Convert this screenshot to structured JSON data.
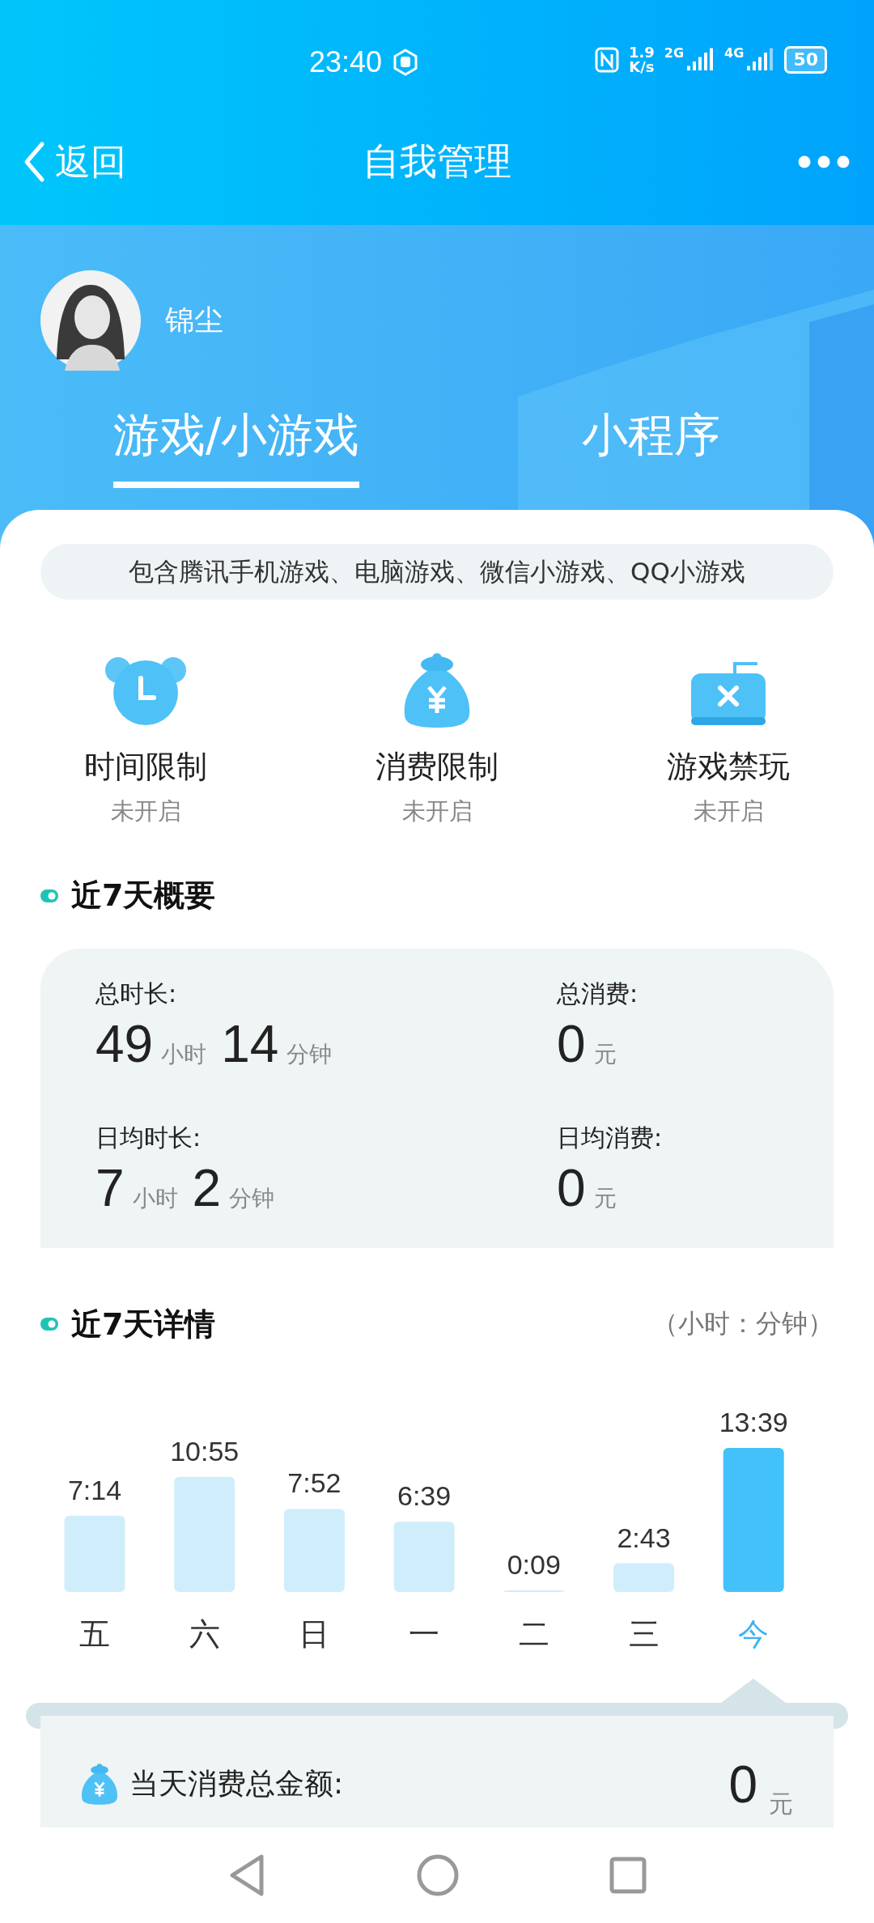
{
  "status_bar": {
    "time": "23:40",
    "speed_value": "1.9",
    "speed_unit": "K/s",
    "network_1": "2G",
    "network_2": "4G",
    "battery": "50"
  },
  "nav": {
    "back": "返回",
    "title": "自我管理"
  },
  "profile": {
    "name": "锦尘"
  },
  "tabs": [
    {
      "label": "游戏/小游戏",
      "selected": true
    },
    {
      "label": "小程序",
      "selected": false
    }
  ],
  "notice": "包含腾讯手机游戏、电脑游戏、微信小游戏、QQ小游戏",
  "controls": [
    {
      "kind": "clock",
      "label": "时间限制",
      "status": "未开启"
    },
    {
      "kind": "moneybag",
      "label": "消费限制",
      "status": "未开启"
    },
    {
      "kind": "gamepad",
      "label": "游戏禁玩",
      "status": "未开启"
    }
  ],
  "summary": {
    "title": "近7天概要",
    "items": [
      {
        "label": "总时长:",
        "parts": [
          {
            "number": "49",
            "unit": "小时"
          },
          {
            "number": "14",
            "unit": "分钟"
          }
        ]
      },
      {
        "label": "总消费:",
        "parts": [
          {
            "number": "0",
            "unit": "元"
          }
        ]
      },
      {
        "label": "日均时长:",
        "parts": [
          {
            "number": "7",
            "unit": "小时"
          },
          {
            "number": "2",
            "unit": "分钟"
          }
        ]
      },
      {
        "label": "日均消费:",
        "parts": [
          {
            "number": "0",
            "unit": "元"
          }
        ]
      }
    ]
  },
  "detail": {
    "title": "近7天详情",
    "unit_note": "（小时：分钟）",
    "days": [
      {
        "selected": false
      },
      {
        "selected": false
      },
      {
        "selected": false
      },
      {
        "selected": false
      },
      {
        "selected": false
      },
      {
        "selected": false
      },
      {
        "selected": true
      }
    ],
    "chart_data": {
      "type": "bar",
      "categories": [
        "五",
        "六",
        "日",
        "一",
        "二",
        "三",
        "今"
      ],
      "values": [
        434,
        655,
        472,
        399,
        9,
        163,
        819
      ],
      "ylim": [
        0,
        819
      ],
      "value_labels": [
        "7:14",
        "10:55",
        "7:52",
        "6:39",
        "0:09",
        "2:43",
        "13:39"
      ]
    }
  },
  "day_panel": {
    "label": "当天消费总金额:",
    "amount": "0",
    "unit": "元"
  }
}
